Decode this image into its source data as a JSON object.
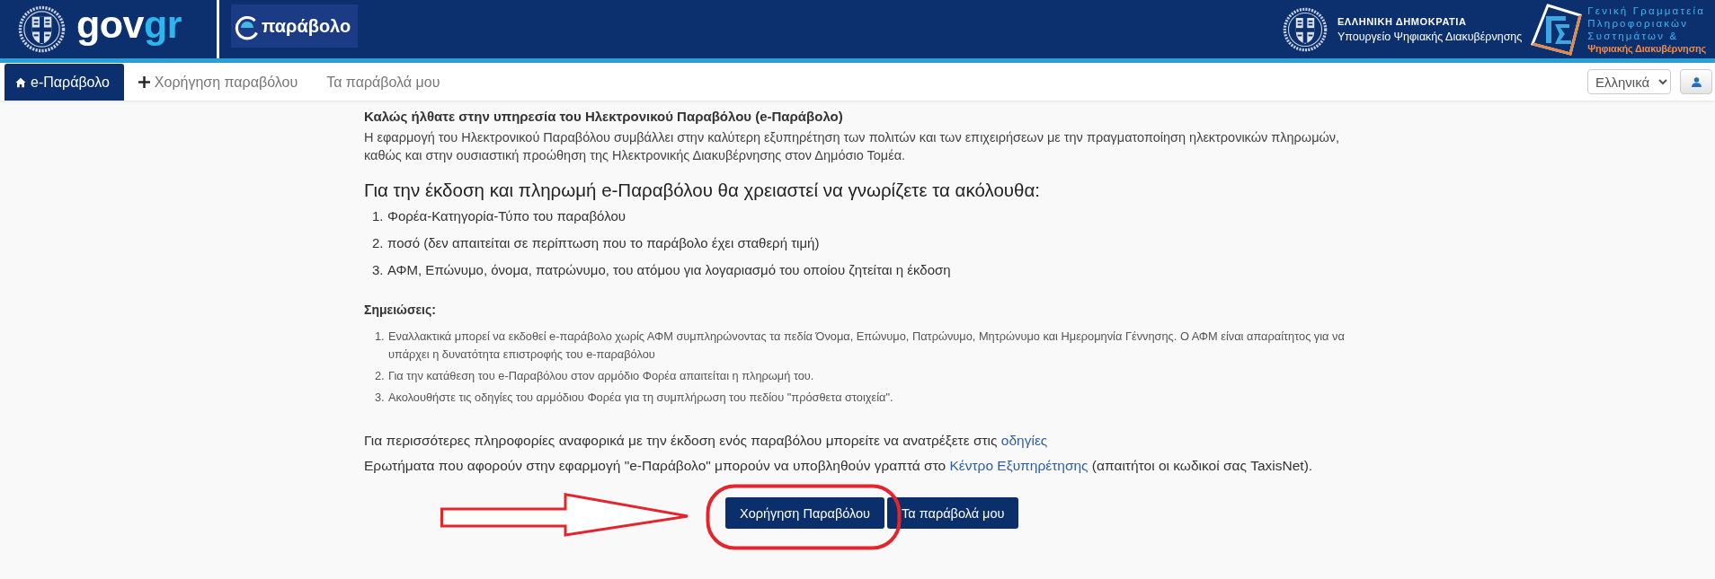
{
  "header": {
    "logo": {
      "primary": "gov",
      "accent": "gr"
    },
    "app_logo": {
      "text": "παράβολο"
    },
    "ministry": {
      "country": "ΕΛΛΗΝΙΚΗ ΔΗΜΟΚΡΑΤΙΑ",
      "name": "Υπουργείο Ψηφιακής Διακυβέρνησης"
    },
    "secretariat": {
      "lines": [
        {
          "text": "Γενική Γραμματεία",
          "kind": "spaced"
        },
        {
          "text": "Πληροφοριακών",
          "kind": "spaced"
        },
        {
          "text": "Συστημάτων &",
          "kind": "spaced"
        },
        {
          "text": "Ψηφιακής Διακυβέρνησης",
          "kind": "accent"
        }
      ]
    }
  },
  "nav": {
    "tabs": [
      {
        "label": "e-Παράβολο",
        "kind": "home",
        "selected": true
      },
      {
        "label": "Χορήγηση παραβόλου",
        "kind": "add",
        "selected": false
      },
      {
        "label": "Τα παράβολά μου",
        "kind": "plain",
        "selected": false
      }
    ],
    "language_select": {
      "value": "Ελληνικά"
    }
  },
  "content": {
    "title": "Καλώς ήλθατε στην υπηρεσία του Ηλεκτρονικού Παραβόλου (e-Παράβολο)",
    "intro": "Η εφαρμογή του Ηλεκτρονικού Παραβόλου συμβάλλει στην καλύτερη εξυπηρέτηση των πολιτών και των επιχειρήσεων με την πραγματοποίηση ηλεκτρονικών πληρωμών, καθώς και στην ουσιαστική προώθηση της Ηλεκτρονικής Διακυβέρνησης στον Δημόσιο Τομέα.",
    "heading": "Για την έκδοση και πληρωμή e-Παραβόλου θα χρειαστεί να γνωρίζετε τα ακόλουθα:",
    "requirements": [
      {
        "number": "1.",
        "text": "Φορέα-Κατηγορία-Τύπο του παραβόλου"
      },
      {
        "number": "2.",
        "text": "ποσό (δεν απαιτείται σε περίπτωση που το παράβολο έχει σταθερή τιμή)"
      },
      {
        "number": "3.",
        "text": "ΑΦΜ, Επώνυμο, όνομα, πατρώνυμο, του ατόμου για λογαριασμό του οποίου ζητείται η έκδοση"
      }
    ],
    "notes_title": "Σημειώσεις:",
    "notes": [
      {
        "number": "1.",
        "text": "Εναλλακτικά μπορεί να εκδοθεί e-παράβολο χωρίς ΑΦΜ συμπληρώνοντας τα πεδία Όνομα, Επώνυμο, Πατρώνυμο, Μητρώνυμο και Ημερομηνία Γέννησης. Ο ΑΦΜ είναι απαραίτητος για να υπάρχει η δυνατότητα επιστροφής του e-παραβόλου"
      },
      {
        "number": "2.",
        "text": "Για την κατάθεση του e-Παραβόλου στον αρμόδιο Φορέα απαιτείται η πληρωμή του."
      },
      {
        "number": "3.",
        "text": "Ακολουθήστε τις οδηγίες του αρμόδιου Φορέα για τη συμπλήρωση του πεδίου \"πρόσθετα στοιχεία\"."
      }
    ],
    "info": [
      {
        "before": "Για περισσότερες πληροφορίες αναφορικά με την έκδοση ενός παραβόλου μπορείτε να ανατρέξετε στις ",
        "link": "οδηγίες"
      },
      {
        "before": "Ερωτήματα που αφορούν στην εφαρμογή \"e-Παράβολο\" μπορούν να υποβληθούν γραπτά στο ",
        "link": "Κέντρο Εξυπηρέτησης",
        "after": " (απαιτήτοι οι κωδικοί σας TaxisNet)."
      }
    ],
    "buttons": [
      {
        "label": "Χορήγηση Παραβόλου"
      },
      {
        "label": "Τα παράβολά μου"
      }
    ]
  }
}
